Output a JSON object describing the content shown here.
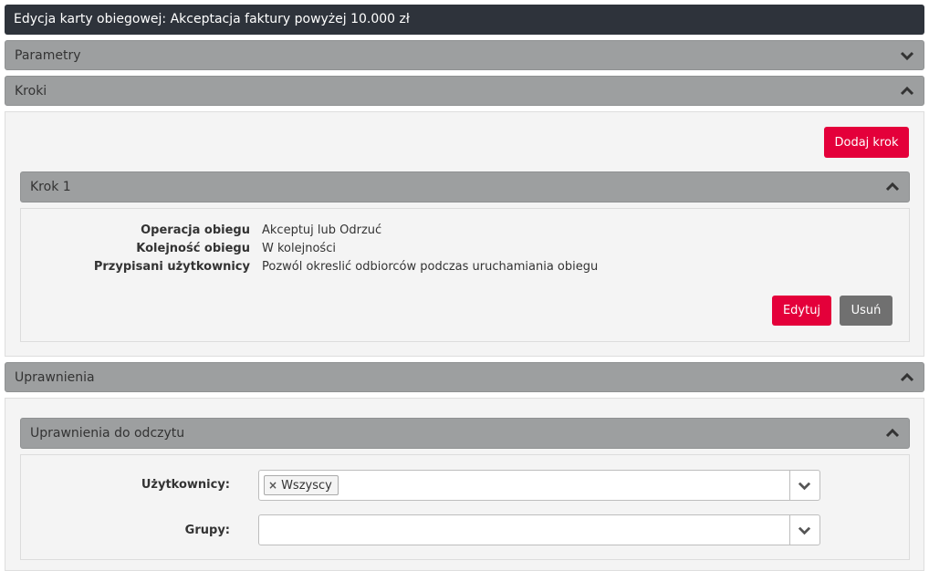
{
  "header": {
    "title": "Edycja karty obiegowej: Akceptacja faktury powyżej 10.000 zł"
  },
  "sections": {
    "parametry": {
      "label": "Parametry",
      "state": "collapsed"
    },
    "kroki": {
      "label": "Kroki",
      "state": "expanded",
      "add_button": "Dodaj krok"
    },
    "krok1": {
      "label": "Krok 1",
      "rows": [
        {
          "label": "Operacja obiegu",
          "value": "Akceptuj lub Odrzuć"
        },
        {
          "label": "Kolejność obiegu",
          "value": "W kolejności"
        },
        {
          "label": "Przypisani użytkownicy",
          "value": "Pozwól okreslić odbiorców podczas uruchamiania obiegu"
        }
      ],
      "edit_button": "Edytuj",
      "delete_button": "Usuń"
    },
    "uprawnienia": {
      "label": "Uprawnienia",
      "state": "expanded"
    },
    "odczyt": {
      "label": "Uprawnienia do odczytu",
      "users_label": "Użytkownicy:",
      "users_tags": [
        "Wszyscy"
      ],
      "tag_remove": "×",
      "groups_label": "Grupy:"
    }
  },
  "colors": {
    "accent": "#e4003a",
    "header_bg": "#2e333b",
    "panel_bg": "#9d9fa0"
  },
  "icons": {
    "expanded": "chevron-up-icon",
    "collapsed": "chevron-down-icon"
  }
}
